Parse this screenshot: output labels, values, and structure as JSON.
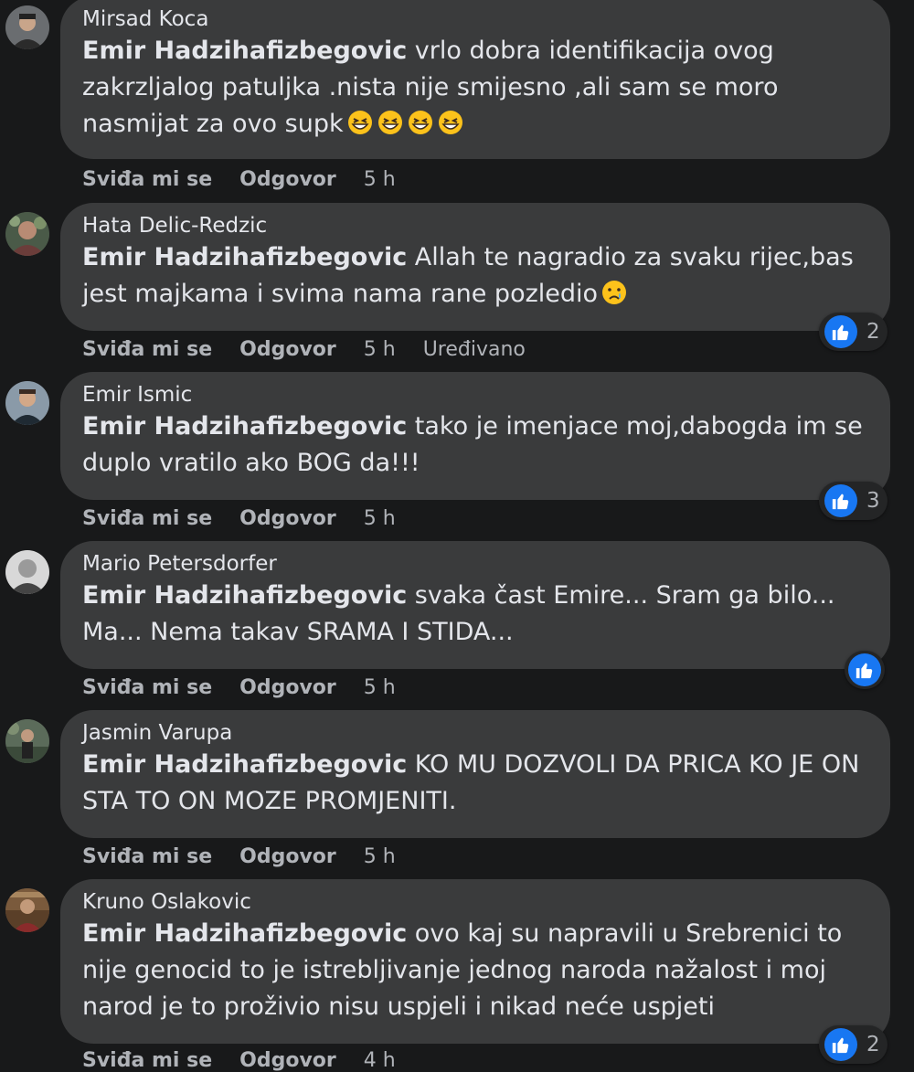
{
  "comments": [
    {
      "author": "Mirsad Koca",
      "mention": "Emir Hadzihafizbegovic",
      "text": " vrlo dobra identifikacija ovog zakrzljalog patuljka .nista nije smijesno ,ali sam se moro nasmijat za ovo supk",
      "emoji": "grinning-squinting-face x4",
      "like": "Sviđa mi se",
      "reply": "Odgovor",
      "time": "5 h",
      "edited": "",
      "reactions": ""
    },
    {
      "author": "Hata Delic-Redzic",
      "mention": "Emir Hadzihafizbegovic",
      "text": " Allah te nagradio za svaku rijec,bas jest majkama i svima nama rane pozledio",
      "emoji": "crying-face",
      "like": "Sviđa mi se",
      "reply": "Odgovor",
      "time": "5 h",
      "edited": "Uređivano",
      "reactions": "2"
    },
    {
      "author": "Emir Ismic",
      "mention": "Emir Hadzihafizbegovic",
      "text": " tako je imenjace moj,dabogda im se duplo vratilo ako BOG da!!!",
      "like": "Sviđa mi se",
      "reply": "Odgovor",
      "time": "5 h",
      "edited": "",
      "reactions": "3"
    },
    {
      "author": "Mario Petersdorfer",
      "mention": "Emir Hadzihafizbegovic",
      "text": " svaka čast Emire... Sram ga bilo... Ma... Nema takav SRAMA I STIDA...",
      "like": "Sviđa mi se",
      "reply": "Odgovor",
      "time": "5 h",
      "edited": "",
      "reactions": ""
    },
    {
      "author": "Jasmin Varupa",
      "mention": "Emir Hadzihafizbegovic",
      "text": " KO MU DOZVOLI DA PRICA KO JE ON STA TO ON MOZE PROMJENITI.",
      "like": "Sviđa mi se",
      "reply": "Odgovor",
      "time": "5 h",
      "edited": "",
      "reactions": ""
    },
    {
      "author": "Kruno Oslakovic",
      "mention": "Emir Hadzihafizbegovic",
      "text": " ovo kaj su napravili u Srebrenici to nije genocid to je istrebljivanje jednog naroda nažalost i moj narod je to proživio nisu uspjeli i nikad neće uspjeti",
      "like": "Sviđa mi se",
      "reply": "Odgovor",
      "time": "4 h",
      "edited": "",
      "reactions": "2"
    }
  ],
  "colors": {
    "background": "#18191a",
    "bubble": "#3a3b3c",
    "text": "#e4e6eb",
    "secondary": "#b0b3b8",
    "like_blue": "#1877f2"
  }
}
